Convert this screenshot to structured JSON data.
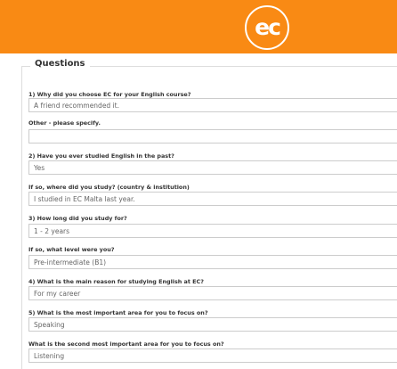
{
  "header": {
    "brand_color": "#f98a14",
    "logo_text": "ec"
  },
  "form": {
    "legend": "Questions",
    "questions": [
      {
        "label": "1) Why did you choose EC for your English course?",
        "value": "A friend recommended it."
      },
      {
        "label": "Other - please specify.",
        "value": ""
      },
      {
        "label": "2) Have you ever studied English in the past?",
        "value": "Yes"
      },
      {
        "label": "If so, where did you study? (country & institution)",
        "value": "I studied in EC Malta last year."
      },
      {
        "label": "3) How long did you study for?",
        "value": "1 - 2 years"
      },
      {
        "label": "If so, what level were you?",
        "value": "Pre-intermediate (B1)"
      },
      {
        "label": "4) What is the main reason for studying English at EC?",
        "value": "For my career"
      },
      {
        "label": "5) What is the most important area for you to focus on?",
        "value": "Speaking"
      },
      {
        "label": "What is the second most important area for you to focus on?",
        "value": "Listening"
      }
    ]
  }
}
